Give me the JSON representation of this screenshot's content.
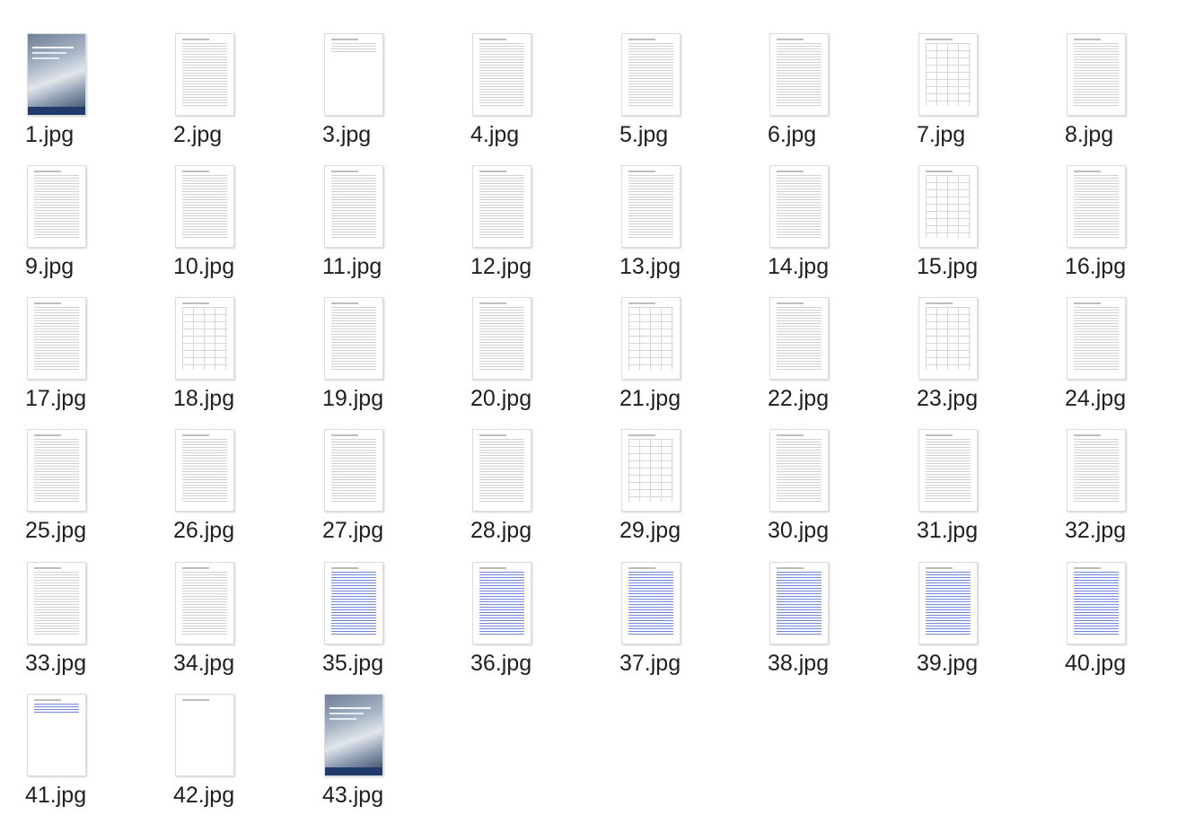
{
  "files": [
    {
      "name": "1.jpg",
      "thumb": "cover"
    },
    {
      "name": "2.jpg",
      "thumb": "text"
    },
    {
      "name": "3.jpg",
      "thumb": "short"
    },
    {
      "name": "4.jpg",
      "thumb": "text"
    },
    {
      "name": "5.jpg",
      "thumb": "text"
    },
    {
      "name": "6.jpg",
      "thumb": "text"
    },
    {
      "name": "7.jpg",
      "thumb": "table"
    },
    {
      "name": "8.jpg",
      "thumb": "text"
    },
    {
      "name": "9.jpg",
      "thumb": "text"
    },
    {
      "name": "10.jpg",
      "thumb": "text"
    },
    {
      "name": "11.jpg",
      "thumb": "text"
    },
    {
      "name": "12.jpg",
      "thumb": "text"
    },
    {
      "name": "13.jpg",
      "thumb": "text"
    },
    {
      "name": "14.jpg",
      "thumb": "text"
    },
    {
      "name": "15.jpg",
      "thumb": "table"
    },
    {
      "name": "16.jpg",
      "thumb": "text"
    },
    {
      "name": "17.jpg",
      "thumb": "text"
    },
    {
      "name": "18.jpg",
      "thumb": "table"
    },
    {
      "name": "19.jpg",
      "thumb": "text"
    },
    {
      "name": "20.jpg",
      "thumb": "text"
    },
    {
      "name": "21.jpg",
      "thumb": "table"
    },
    {
      "name": "22.jpg",
      "thumb": "text"
    },
    {
      "name": "23.jpg",
      "thumb": "table"
    },
    {
      "name": "24.jpg",
      "thumb": "text"
    },
    {
      "name": "25.jpg",
      "thumb": "text"
    },
    {
      "name": "26.jpg",
      "thumb": "text"
    },
    {
      "name": "27.jpg",
      "thumb": "text"
    },
    {
      "name": "28.jpg",
      "thumb": "text"
    },
    {
      "name": "29.jpg",
      "thumb": "table"
    },
    {
      "name": "30.jpg",
      "thumb": "text"
    },
    {
      "name": "31.jpg",
      "thumb": "text"
    },
    {
      "name": "32.jpg",
      "thumb": "text"
    },
    {
      "name": "33.jpg",
      "thumb": "text"
    },
    {
      "name": "34.jpg",
      "thumb": "text"
    },
    {
      "name": "35.jpg",
      "thumb": "blue"
    },
    {
      "name": "36.jpg",
      "thumb": "blue"
    },
    {
      "name": "37.jpg",
      "thumb": "blue"
    },
    {
      "name": "38.jpg",
      "thumb": "blue"
    },
    {
      "name": "39.jpg",
      "thumb": "blue"
    },
    {
      "name": "40.jpg",
      "thumb": "blue"
    },
    {
      "name": "41.jpg",
      "thumb": "blue-short"
    },
    {
      "name": "42.jpg",
      "thumb": "blank"
    },
    {
      "name": "43.jpg",
      "thumb": "cover"
    }
  ]
}
